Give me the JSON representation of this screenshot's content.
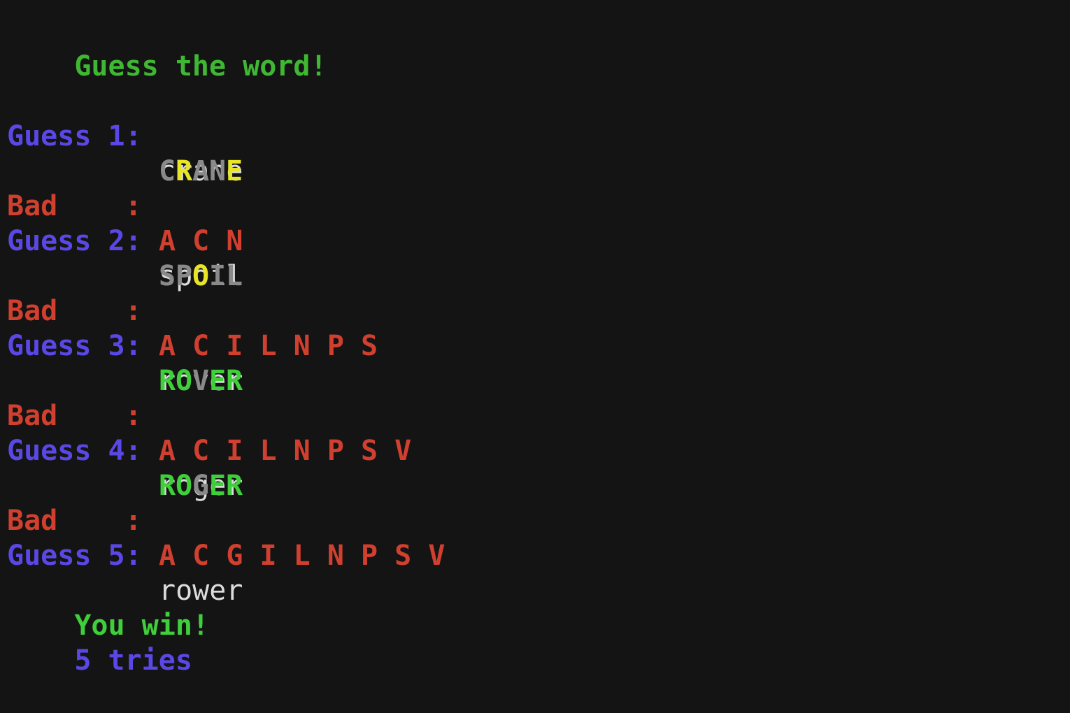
{
  "title": "Guess the word!",
  "colors": {
    "title": "#3fb733",
    "guess_label": "#5a48e6",
    "bad_label": "#d1402f",
    "correct": "#3fcf3a",
    "present": "#e8e426",
    "absent": "#8a8a8a",
    "input": "#dcdcdc",
    "background": "#141414"
  },
  "guesses": [
    {
      "label": "Guess 1:",
      "word": "crane",
      "feedback": [
        {
          "ch": "C",
          "state": "absent"
        },
        {
          "ch": "R",
          "state": "present"
        },
        {
          "ch": "A",
          "state": "absent"
        },
        {
          "ch": "N",
          "state": "absent"
        },
        {
          "ch": "E",
          "state": "present"
        }
      ],
      "bad_label": "Bad    :",
      "bad_letters": "A C N"
    },
    {
      "label": "Guess 2:",
      "word": "spoil",
      "feedback": [
        {
          "ch": "S",
          "state": "absent"
        },
        {
          "ch": "P",
          "state": "absent"
        },
        {
          "ch": "O",
          "state": "present"
        },
        {
          "ch": "I",
          "state": "absent"
        },
        {
          "ch": "L",
          "state": "absent"
        }
      ],
      "bad_label": "Bad    :",
      "bad_letters": "A C I L N P S"
    },
    {
      "label": "Guess 3:",
      "word": "rover",
      "feedback": [
        {
          "ch": "R",
          "state": "correct"
        },
        {
          "ch": "O",
          "state": "correct"
        },
        {
          "ch": "V",
          "state": "absent"
        },
        {
          "ch": "E",
          "state": "correct"
        },
        {
          "ch": "R",
          "state": "correct"
        }
      ],
      "bad_label": "Bad    :",
      "bad_letters": "A C I L N P S V"
    },
    {
      "label": "Guess 4:",
      "word": "roger",
      "feedback": [
        {
          "ch": "R",
          "state": "correct"
        },
        {
          "ch": "O",
          "state": "correct"
        },
        {
          "ch": "G",
          "state": "absent"
        },
        {
          "ch": "E",
          "state": "correct"
        },
        {
          "ch": "R",
          "state": "correct"
        }
      ],
      "bad_label": "Bad    :",
      "bad_letters": "A C G I L N P S V"
    }
  ],
  "final_guess": {
    "label": "Guess 5:",
    "word": "rower"
  },
  "result": "You win!",
  "tries": "5 tries"
}
